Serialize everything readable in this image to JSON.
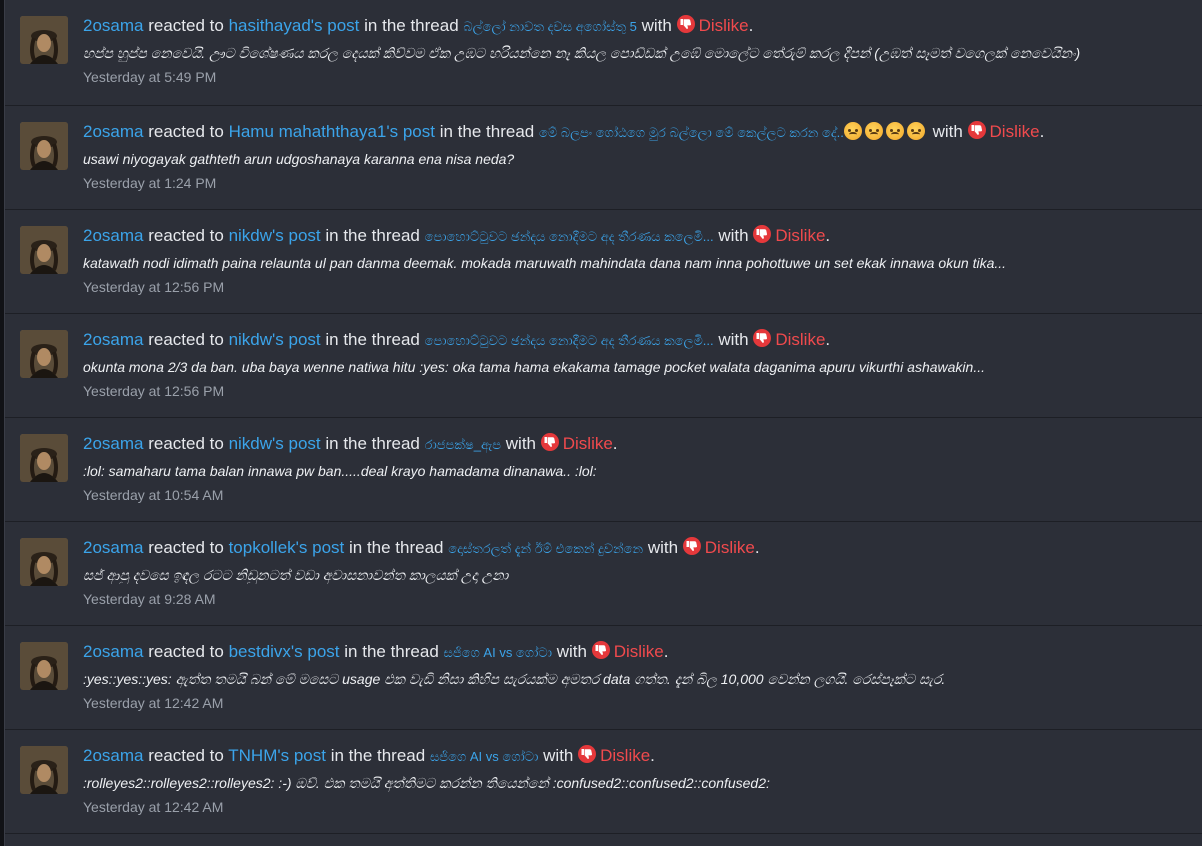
{
  "common": {
    "reacted_to": "reacted to",
    "in_the_thread": "in the thread",
    "with": "with",
    "reaction_label": "Dislike",
    "period": ".",
    "avatar_icon": "avatar-icon",
    "reaction_icon": "thumbs-down-icon",
    "colors": {
      "link": "#3ba4ea",
      "dislike": "#f04a4d",
      "background": "#2c2f38",
      "timestamp": "#9aa0aa"
    }
  },
  "items": [
    {
      "user": "2osama",
      "post_owner": "hasithayad's post",
      "thread": "බල්ලෝ නාවත දවස අගෝස්තු 5",
      "thread_emojis": 0,
      "snippet": "හප්ප හුප්ප නෙවෙයි. ඌට විශේෂණය කරල දෙයක් කිව්වම ඒක උඹට හරියන්නෙ නෑ කියල පොඩ්ඩක් උඹේ මොලේට තේරුම් කරල දීපන් (උඹත් සෑමත් වගෙලක් නෙවෙයිනං)",
      "time": "Yesterday at 5:49 PM"
    },
    {
      "user": "2osama",
      "post_owner": "Hamu mahaththaya1's post",
      "thread": "මේ බලපං ගෝඨගෙ මුර බල්ලො මේ කෙල්ලට කරන දේ..",
      "thread_emojis": 4,
      "snippet": "usawi niyogayak gathteth arun udgoshanaya karanna ena nisa neda?",
      "time": "Yesterday at 1:24 PM"
    },
    {
      "user": "2osama",
      "post_owner": "nikdw's post",
      "thread": "පොහොට්ටුවට ඡන්දය නොදීමට අද තීරණය කලෙමි...",
      "thread_emojis": 0,
      "snippet": "katawath nodi idimath paina relaunta ul pan danma deemak. mokada maruwath mahindata dana nam inna pohottuwe un set ekak innawa okun tika...",
      "time": "Yesterday at 12:56 PM"
    },
    {
      "user": "2osama",
      "post_owner": "nikdw's post",
      "thread": "පොහොට්ටුවට ඡන්දය නොදීමට අද තීරණය කලෙමි...",
      "thread_emojis": 0,
      "snippet": "okunta mona 2/3 da ban. uba baya wenne natiwa hitu :yes: oka tama hama ekakama tamage pocket walata daganima apuru vikurthi ashawakin...",
      "time": "Yesterday at 12:56 PM"
    },
    {
      "user": "2osama",
      "post_owner": "nikdw's post",
      "thread": "රාජපක්ෂ_ඇප",
      "thread_emojis": 0,
      "snippet": ":lol: samaharu tama balan innawa pw ban.....deal krayo hamadama dinanawa.. :lol:",
      "time": "Yesterday at 10:54 AM"
    },
    {
      "user": "2osama",
      "post_owner": "topkollek's post",
      "thread": "දොස්තරලත් දැන් ඊම් එකෙන් දුවන්නෙ",
      "thread_emojis": 0,
      "snippet": "සජ් ආපු දවසෙ ඉඳල රටට නිඩුනටත් වඩා අවාසනාවන්ත කාලයක් උදා උනා",
      "time": "Yesterday at 9:28 AM"
    },
    {
      "user": "2osama",
      "post_owner": "bestdivx's post",
      "thread": "සජිගෙ AI vs ගෝටා",
      "thread_emojis": 0,
      "snippet": ":yes::yes::yes: ඇත්ත තමයි බන් මේ මසෙට usage එක වැඩි නිසා කිහිප සැරයක්ම අමතර data ගත්ත. දැන් බිල 10,000 වෙන්න ලගයි. රෙස්පෑක්ට සැර.",
      "time": "Yesterday at 12:42 AM"
    },
    {
      "user": "2osama",
      "post_owner": "TNHM's post",
      "thread": "සජිගෙ AI vs ගෝටා",
      "thread_emojis": 0,
      "snippet": ":rolleyes2::rolleyes2::rolleyes2: :-) ඔව්. එක තමයි අත්තිමට කරන්න තියෙන්නේ :confused2::confused2::confused2:",
      "time": "Yesterday at 12:42 AM"
    }
  ]
}
